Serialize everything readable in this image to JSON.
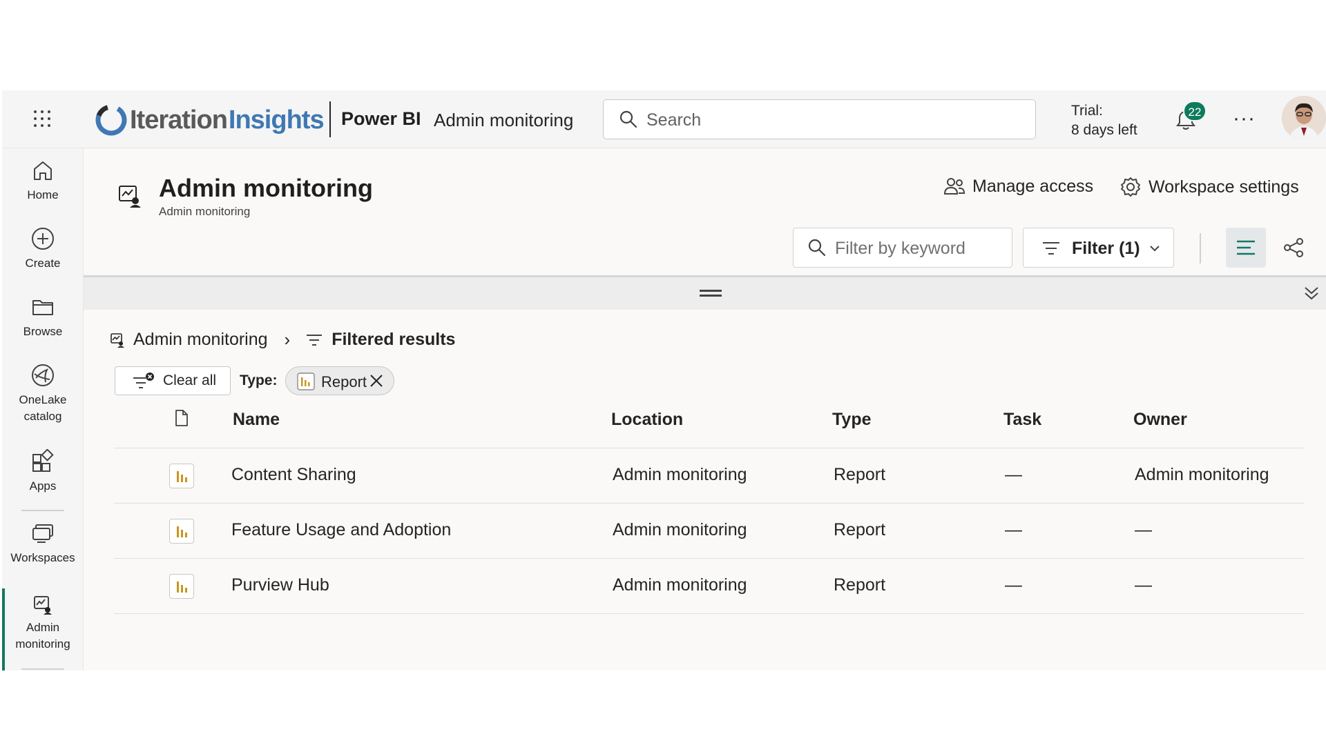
{
  "topbar": {
    "logo_word_1": "Iteration",
    "logo_word_2": "Insights",
    "product": "Power BI",
    "current_workspace": "Admin monitoring",
    "search_placeholder": "Search",
    "trial_line1": "Trial:",
    "trial_line2": "8 days left",
    "notification_count": "22",
    "more_label": "···"
  },
  "nav": {
    "items": [
      {
        "label": "Home",
        "icon": "home-icon"
      },
      {
        "label": "Create",
        "icon": "plus-circle-icon"
      },
      {
        "label": "Browse",
        "icon": "folder-icon"
      },
      {
        "label": "OneLake catalog",
        "icon": "onelake-icon"
      },
      {
        "label": "Apps",
        "icon": "apps-icon"
      },
      {
        "label": "Workspaces",
        "icon": "workspaces-icon"
      },
      {
        "label": "Admin monitoring",
        "icon": "workspace-monitor-icon",
        "active": true
      }
    ]
  },
  "workspace": {
    "title": "Admin monitoring",
    "subtitle": "Admin monitoring",
    "manage_access": "Manage access",
    "workspace_settings": "Workspace settings",
    "keyword_placeholder": "Filter by keyword",
    "filter_label": "Filter (1)"
  },
  "breadcrumb": {
    "root": "Admin monitoring",
    "current": "Filtered results"
  },
  "filters": {
    "clear_all": "Clear all",
    "type_label": "Type:",
    "chip": "Report"
  },
  "table": {
    "headers": {
      "name": "Name",
      "location": "Location",
      "type": "Type",
      "task": "Task",
      "owner": "Owner"
    },
    "rows": [
      {
        "name": "Content Sharing",
        "location": "Admin monitoring",
        "type": "Report",
        "task": "—",
        "owner": "Admin monitoring"
      },
      {
        "name": "Feature Usage and Adoption",
        "location": "Admin monitoring",
        "type": "Report",
        "task": "—",
        "owner": "—"
      },
      {
        "name": "Purview Hub",
        "location": "Admin monitoring",
        "type": "Report",
        "task": "—",
        "owner": "—"
      }
    ]
  },
  "colors": {
    "accent": "#117865",
    "badge": "#0e7a5d",
    "report_icon": "#c8961e",
    "logo_blue": "#3f78b4"
  }
}
